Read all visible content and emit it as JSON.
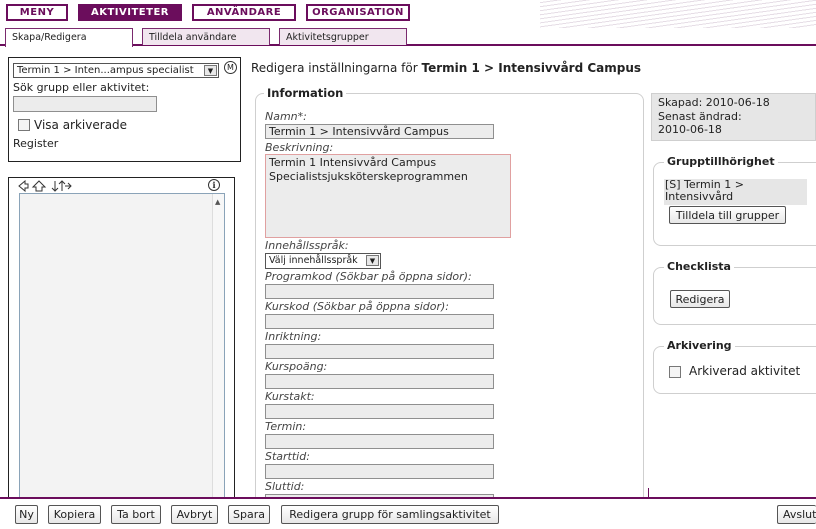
{
  "nav": {
    "menu": "MENY",
    "activities": "AKTIVITETER",
    "users": "ANVÄNDARE",
    "organisation": "ORGANISATION"
  },
  "tabs": [
    "Skapa/Redigera",
    "Tilldela användare",
    "Aktivitetsgrupper"
  ],
  "left": {
    "selected_activity": "Termin 1 > Inten...ampus specialist",
    "search_label": "Sök grupp eller aktivitet:",
    "search_value": "",
    "show_archived": "Visa arkiverade",
    "register_link": "Register"
  },
  "tree_toolbar_icons": [
    "arrow-left-icon",
    "arrow-up-icon",
    "double-arrow-icon",
    "info-icon"
  ],
  "main": {
    "heading_prefix": "Redigera inställningarna för",
    "heading_name": "Termin 1 > Intensivvård Campus",
    "info_legend": "Information",
    "name_label": "Namn*:",
    "name_value": "Termin 1 > Intensivvård Campus",
    "desc_label": "Beskrivning:",
    "desc_value": "Termin 1 Intensivvård Campus\nSpecialistsjuksköterskeprogrammen",
    "lang_label": "Innehållsspråk:",
    "lang_value": "Välj innehållsspråk",
    "programkod_label": "Programkod (Sökbar på öppna sidor):",
    "programkod_value": "",
    "kurskod_label": "Kurskod (Sökbar på öppna sidor):",
    "kurskod_value": "",
    "inriktning_label": "Inriktning:",
    "inriktning_value": "",
    "kurspoang_label": "Kurspoäng:",
    "kurspoang_value": "",
    "kurstakt_label": "Kurstakt:",
    "kurstakt_value": "",
    "termin_label": "Termin:",
    "termin_value": "",
    "starttid_label": "Starttid:",
    "starttid_value": "",
    "sluttid_label": "Sluttid:",
    "sluttid_value": ""
  },
  "side": {
    "created": "Skapad: 2010-06-18",
    "modified_label": "Senast ändrad:",
    "modified_date": "2010-06-18",
    "group_legend": "Grupptillhörighet",
    "group_item_line1": "[S] Termin 1 >",
    "group_item_line2": "Intensivvård",
    "assign_button": "Tilldela till grupper",
    "checklist_legend": "Checklista",
    "checklist_button": "Redigera",
    "archive_legend": "Arkivering",
    "archive_label": "Arkiverad aktivitet"
  },
  "bottom": {
    "new": "Ny",
    "copy": "Kopiera",
    "delete": "Ta bort",
    "cancel": "Avbryt",
    "save": "Spara",
    "edit_group": "Redigera grupp för samlingsaktivitet",
    "quit": "Avslut"
  },
  "colors": {
    "accent": "#6b0d5c",
    "tab_bg": "#f1e6ef",
    "field_bg": "#ececec",
    "error_border": "#e0a0a0"
  }
}
